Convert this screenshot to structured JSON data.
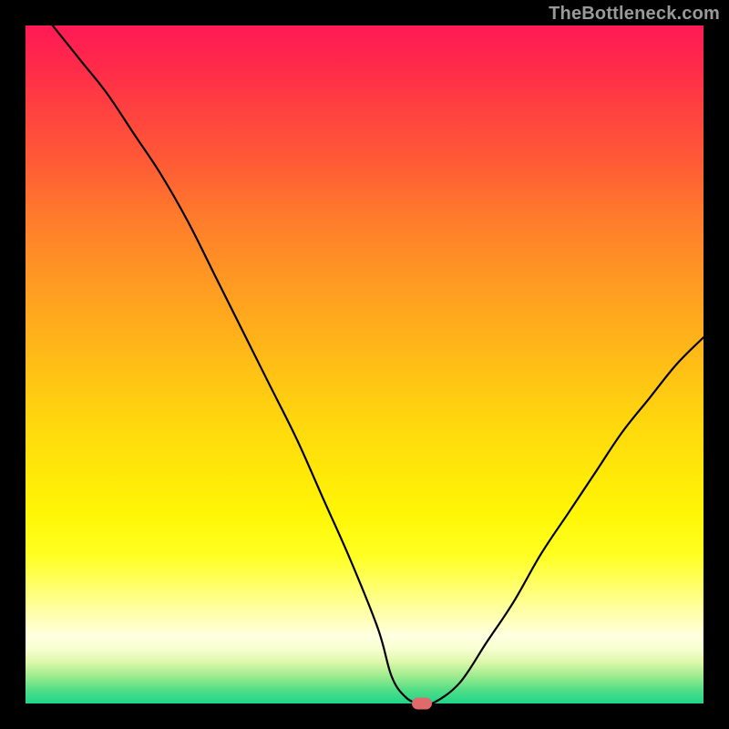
{
  "watermark": "TheBottleneck.com",
  "chart_data": {
    "type": "line",
    "title": "",
    "xlabel": "",
    "ylabel": "",
    "xlim": [
      0,
      100
    ],
    "ylim": [
      0,
      100
    ],
    "x": [
      4,
      8,
      12,
      16,
      20,
      24,
      28,
      32,
      36,
      40,
      44,
      48,
      52,
      54,
      56,
      58,
      60,
      64,
      68,
      72,
      76,
      80,
      84,
      88,
      92,
      96,
      100
    ],
    "values": [
      100,
      95,
      90,
      84,
      78,
      71,
      63,
      55,
      47,
      39,
      30,
      21,
      11,
      4,
      1,
      0,
      0,
      3,
      9,
      15,
      22,
      28,
      34,
      40,
      45,
      50,
      54
    ],
    "marker": {
      "x": 58.5,
      "y": 0,
      "color": "#e06a6a"
    },
    "gradient_stops": [
      {
        "pct": 0,
        "color": "#ff1a55"
      },
      {
        "pct": 50,
        "color": "#ffd60e"
      },
      {
        "pct": 90,
        "color": "#ffffe0"
      },
      {
        "pct": 100,
        "color": "#1dd68b"
      }
    ]
  }
}
